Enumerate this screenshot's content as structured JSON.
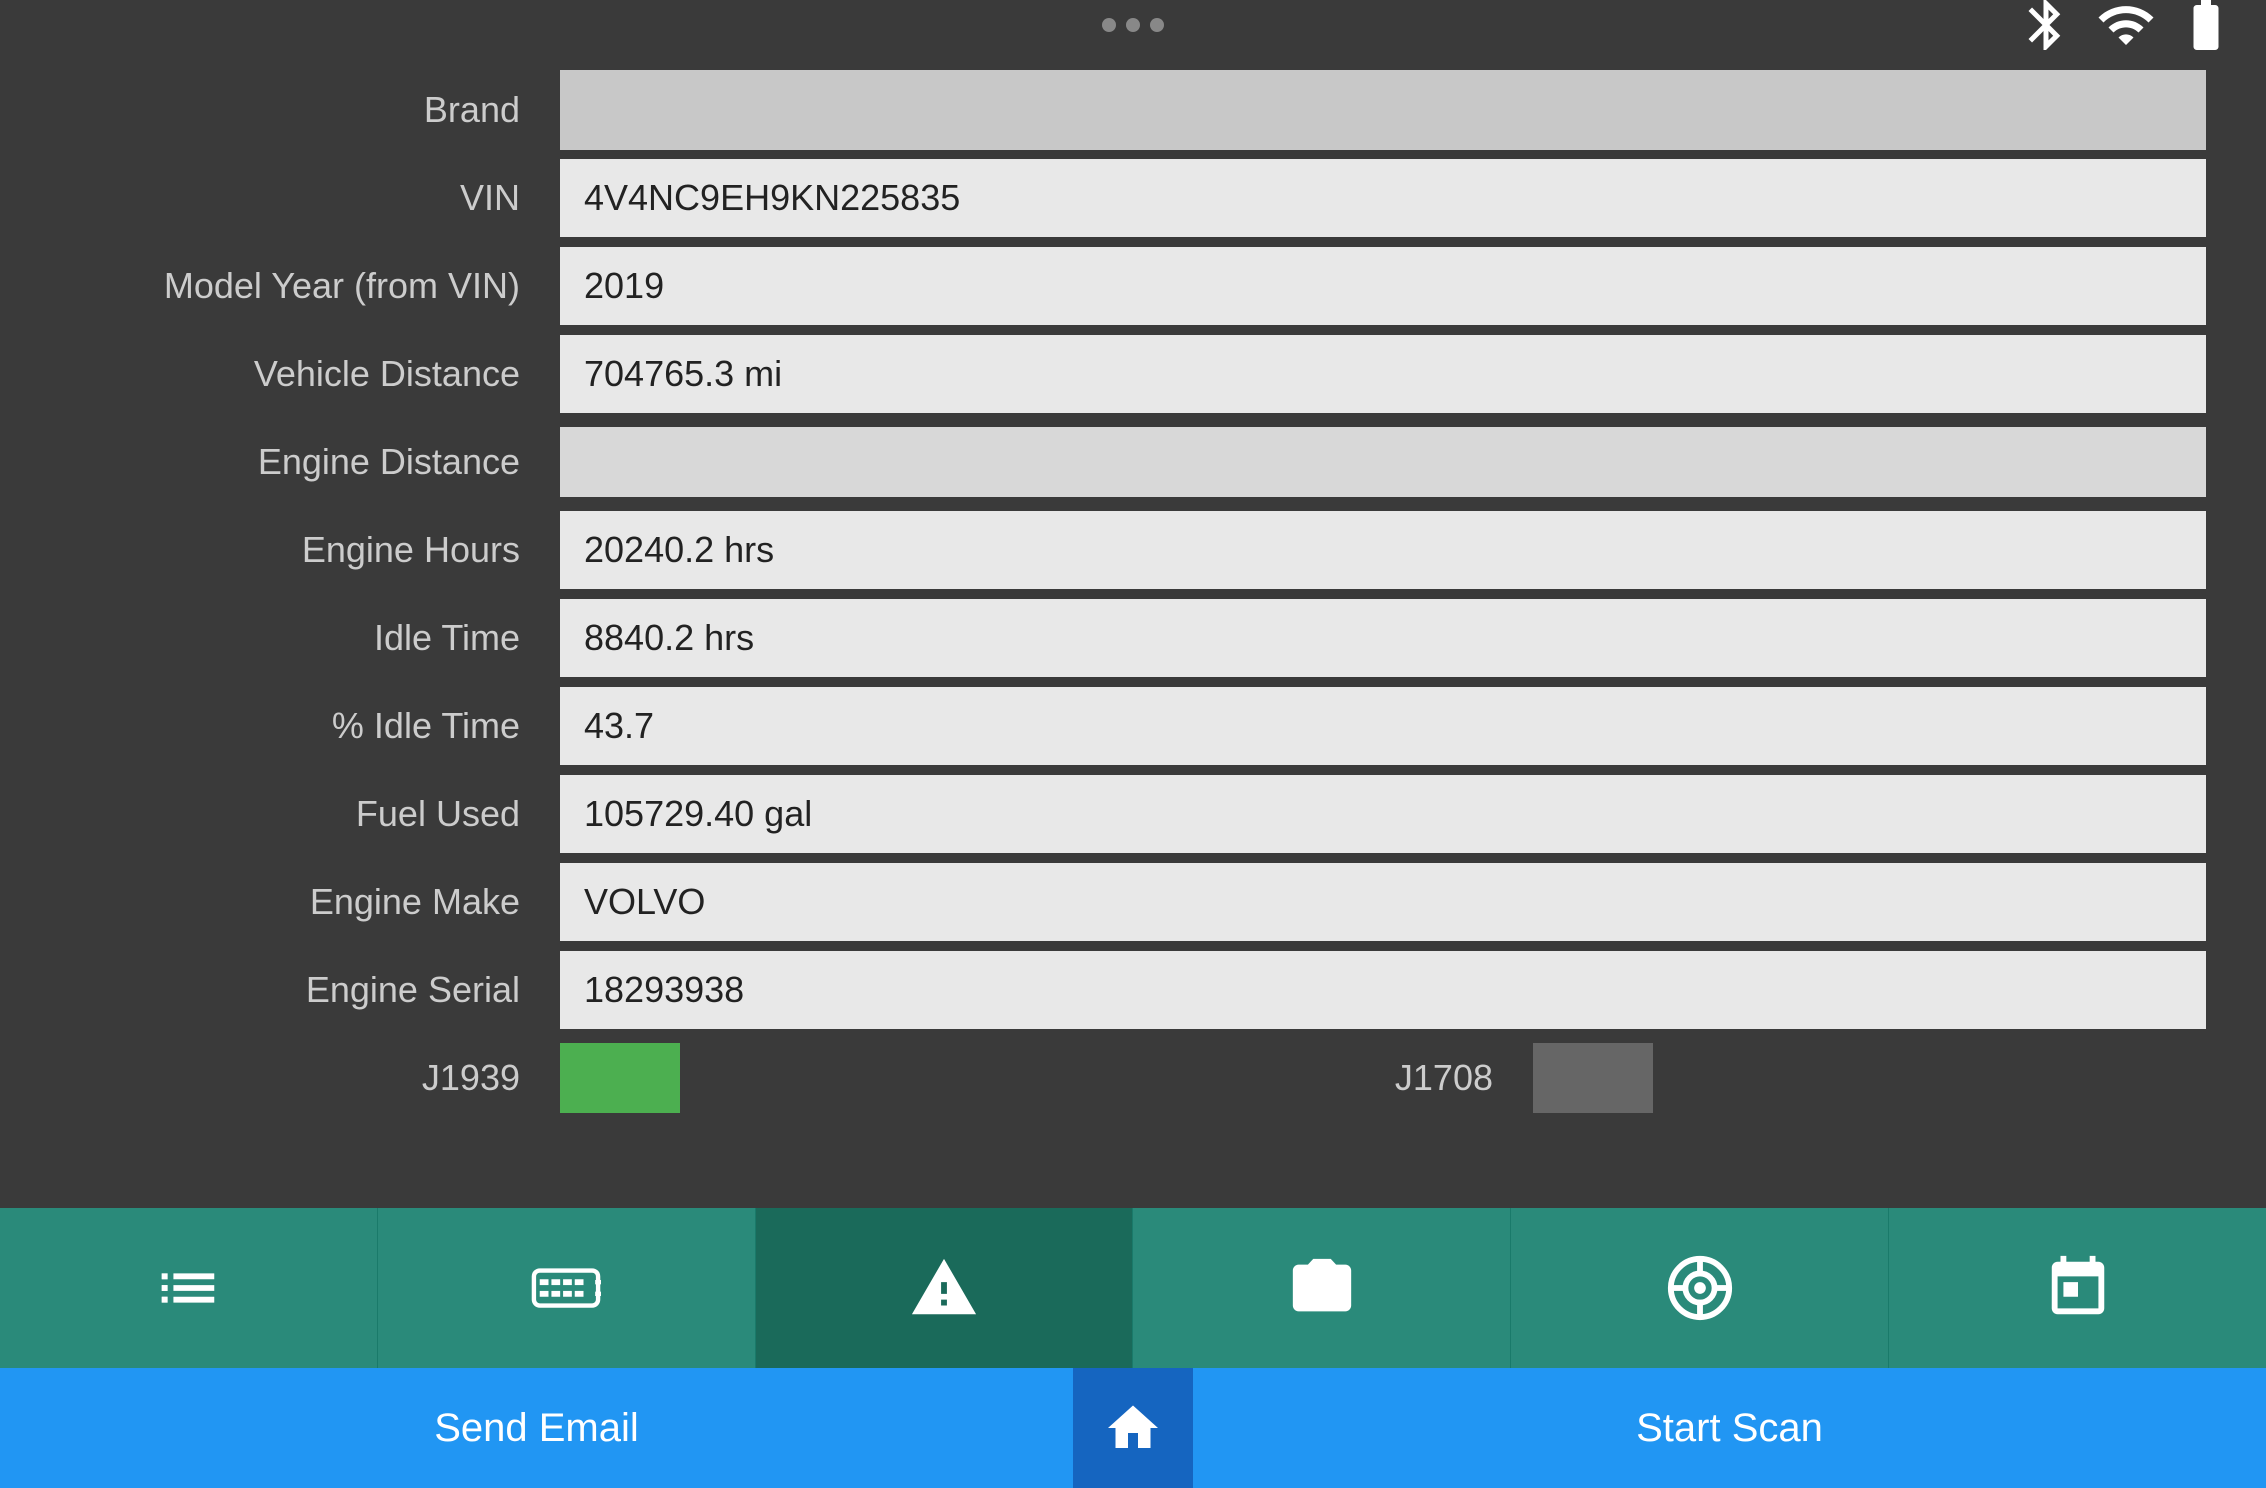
{
  "topBar": {
    "dots": 3
  },
  "topIcons": {
    "bluetooth": "bluetooth-icon",
    "signal": "signal-icon",
    "battery": "battery-icon"
  },
  "form": {
    "brandLabel": "Brand",
    "brandValue": "",
    "vinLabel": "VIN",
    "vinValue": "4V4NC9EH9KN225835",
    "modelYearLabel": "Model Year (from VIN)",
    "modelYearValue": "2019",
    "vehicleDistanceLabel": "Vehicle Distance",
    "vehicleDistanceValue": "704765.3 mi",
    "engineDistanceLabel": "Engine Distance",
    "engineDistanceValue": "",
    "engineHoursLabel": "Engine Hours",
    "engineHoursValue": "20240.2 hrs",
    "idleTimeLabel": "Idle Time",
    "idleTimeValue": "8840.2 hrs",
    "percentIdleTimeLabel": "% Idle Time",
    "percentIdleTimeValue": "43.7",
    "fuelUsedLabel": "Fuel Used",
    "fuelUsedValue": "105729.40 gal",
    "engineMakeLabel": "Engine Make",
    "engineMakeValue": "VOLVO",
    "engineSerialLabel": "Engine Serial",
    "engineSerialValue": "18293938",
    "j1939Label": "J1939",
    "j1939ToggleState": "on",
    "j1708Label": "J1708",
    "j1708ToggleState": "off"
  },
  "bottomNav": {
    "items": [
      {
        "name": "checklist",
        "label": "Checklist"
      },
      {
        "name": "obd",
        "label": "OBD"
      },
      {
        "name": "fault",
        "label": "Fault"
      },
      {
        "name": "camera",
        "label": "Camera"
      },
      {
        "name": "tire",
        "label": "Tire"
      },
      {
        "name": "calendar",
        "label": "Calendar"
      }
    ]
  },
  "actionBar": {
    "sendEmailLabel": "Send Email",
    "homeLabel": "🏠",
    "startScanLabel": "Start Scan"
  }
}
